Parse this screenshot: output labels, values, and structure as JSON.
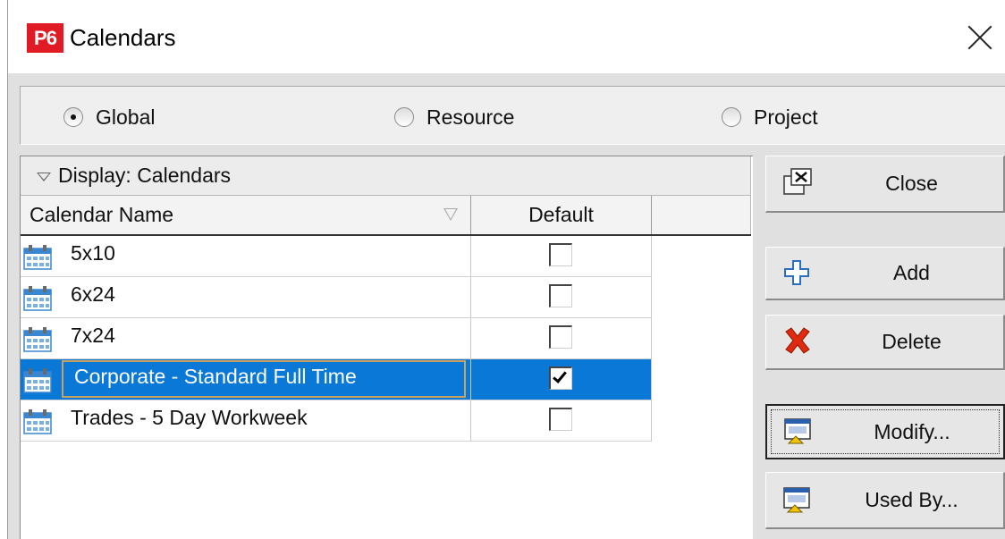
{
  "window": {
    "app_icon_text": "P6",
    "title": "Calendars"
  },
  "scope": {
    "options": [
      {
        "label": "Global",
        "selected": true
      },
      {
        "label": "Resource",
        "selected": false
      },
      {
        "label": "Project",
        "selected": false
      }
    ]
  },
  "grid": {
    "display_label": "Display: Calendars",
    "columns": {
      "name": "Calendar Name",
      "default": "Default"
    },
    "rows": [
      {
        "name": "5x10",
        "default": false
      },
      {
        "name": "6x24",
        "default": false
      },
      {
        "name": "7x24",
        "default": false
      },
      {
        "name": "Corporate - Standard Full Time",
        "default": true
      },
      {
        "name": "Trades -  5 Day Workweek",
        "default": false
      }
    ],
    "selected_row": 3
  },
  "buttons": {
    "close": "Close",
    "add": "Add",
    "delete": "Delete",
    "modify": "Modify...",
    "used_by": "Used By..."
  },
  "colors": {
    "selection": "#0a78d7",
    "app_icon_bg": "#e01b24",
    "calendar_icon": "#3a86d0"
  },
  "icons": {
    "title": "p6-app-icon",
    "row": "calendar-icon",
    "close": "close-window-icon",
    "add": "plus-icon",
    "delete": "red-x-icon",
    "modify": "modify-icon",
    "used_by": "used-by-icon"
  }
}
